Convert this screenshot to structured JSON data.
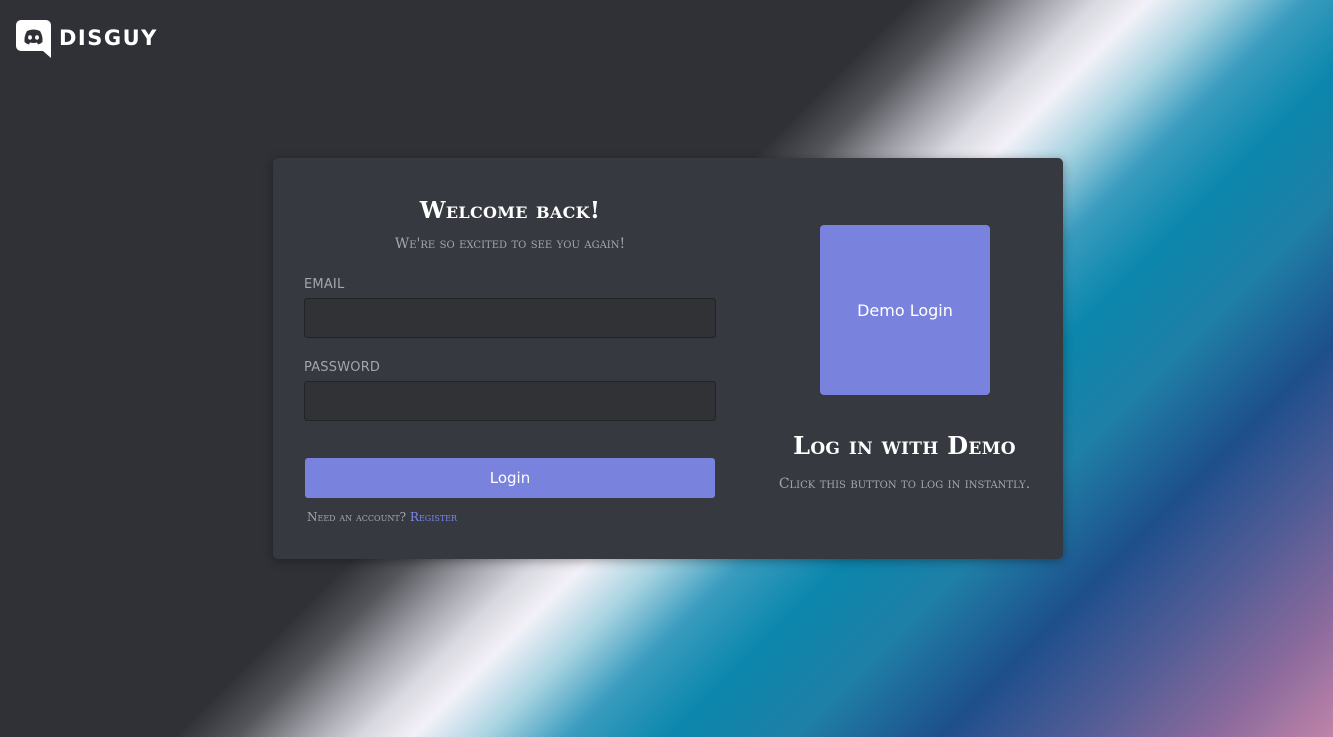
{
  "brand": {
    "name": "DISGUY",
    "icon": "discord-logo-icon"
  },
  "login_form": {
    "title": "Welcome back!",
    "subtitle": "We're so excited to see you again!",
    "email_label": "EMAIL",
    "email_value": "",
    "password_label": "PASSWORD",
    "password_value": "",
    "login_button_label": "Login",
    "register_prompt": "Need an account?",
    "register_link_label": "Register"
  },
  "demo": {
    "button_label": "Demo Login",
    "title": "Log in with Demo",
    "subtitle": "Click this button to log in instantly."
  },
  "colors": {
    "accent": "#7983de",
    "card_background": "#36393f",
    "page_background": "#2f3136",
    "input_background": "#303236",
    "muted_text": "#a2a6ad",
    "link": "#7b86e8"
  }
}
